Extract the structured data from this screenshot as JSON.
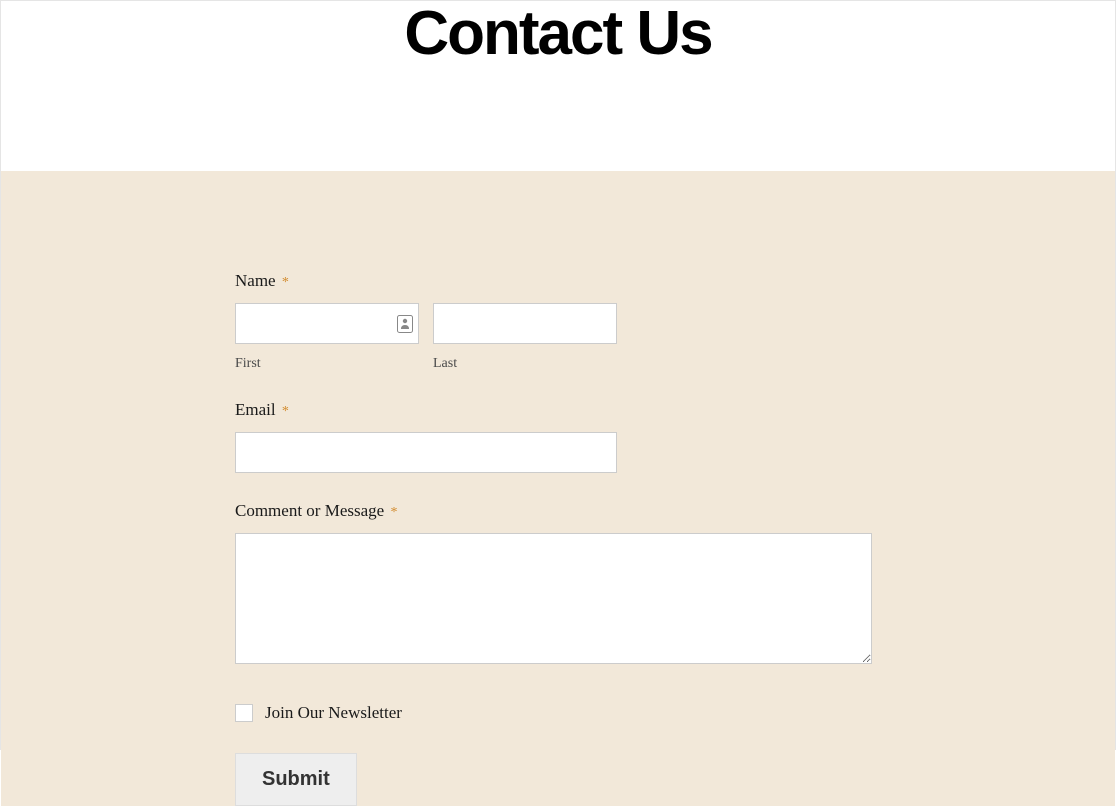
{
  "header": {
    "title": "Contact Us"
  },
  "form": {
    "name": {
      "label": "Name",
      "required": "*",
      "first_sublabel": "First",
      "last_sublabel": "Last"
    },
    "email": {
      "label": "Email",
      "required": "*"
    },
    "comment": {
      "label": "Comment or Message",
      "required": "*"
    },
    "newsletter": {
      "label": "Join Our Newsletter"
    },
    "submit": {
      "label": "Submit"
    }
  }
}
